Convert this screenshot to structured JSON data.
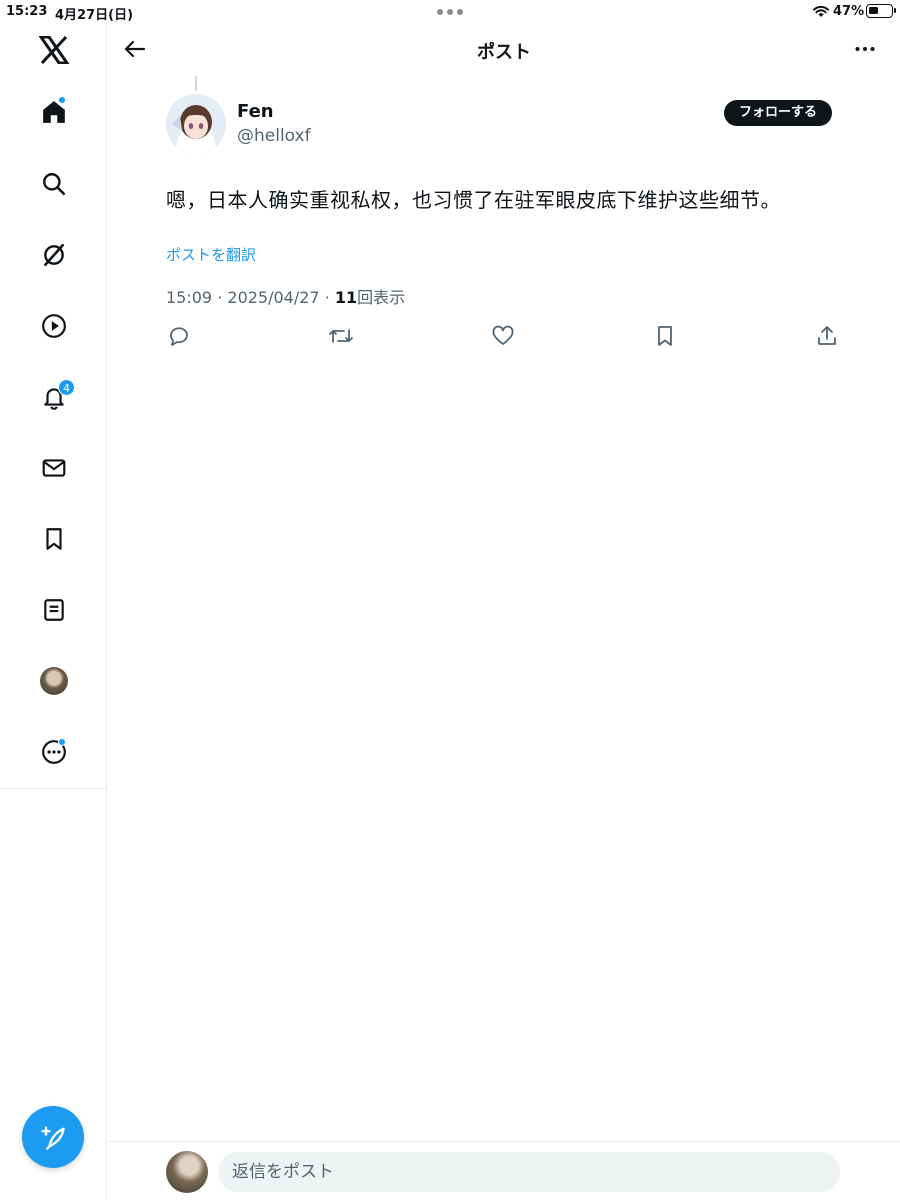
{
  "status_bar": {
    "time": "15:23",
    "date": "4月27日(日)",
    "battery_percent": "47%",
    "battery_level": 0.47
  },
  "sidebar": {
    "items": [
      {
        "name": "x-logo-icon"
      },
      {
        "name": "home-icon",
        "has_dot": true
      },
      {
        "name": "search-icon"
      },
      {
        "name": "grok-icon"
      },
      {
        "name": "video-icon"
      },
      {
        "name": "notifications-icon",
        "badge": "4"
      },
      {
        "name": "messages-icon"
      },
      {
        "name": "bookmarks-icon"
      },
      {
        "name": "lists-icon"
      },
      {
        "name": "profile-avatar"
      },
      {
        "name": "more-icon",
        "has_dot": true
      }
    ],
    "compose_icon": "compose-post-icon"
  },
  "header": {
    "title": "ポスト",
    "back_icon": "arrow-left-icon",
    "more_icon": "more-horizontal-icon"
  },
  "post": {
    "author": {
      "name": "Fen",
      "handle": "@helloxf"
    },
    "follow_label": "フォローする",
    "text": "嗯，日本人确实重视私权，也习惯了在驻军眼皮底下维护这些细节。",
    "translate_label": "ポストを翻訳",
    "time": "15:09",
    "date": "2025/04/27",
    "separator": "·",
    "views_count": "11",
    "views_label": "回表示",
    "actions": [
      "reply-icon",
      "repost-icon",
      "like-icon",
      "bookmark-icon",
      "share-icon"
    ]
  },
  "reply_bar": {
    "placeholder": "返信をポスト"
  },
  "colors": {
    "accent": "#1d9bf0",
    "text_primary": "#0f1419",
    "text_secondary": "#536471",
    "border": "#e6ecf0"
  }
}
